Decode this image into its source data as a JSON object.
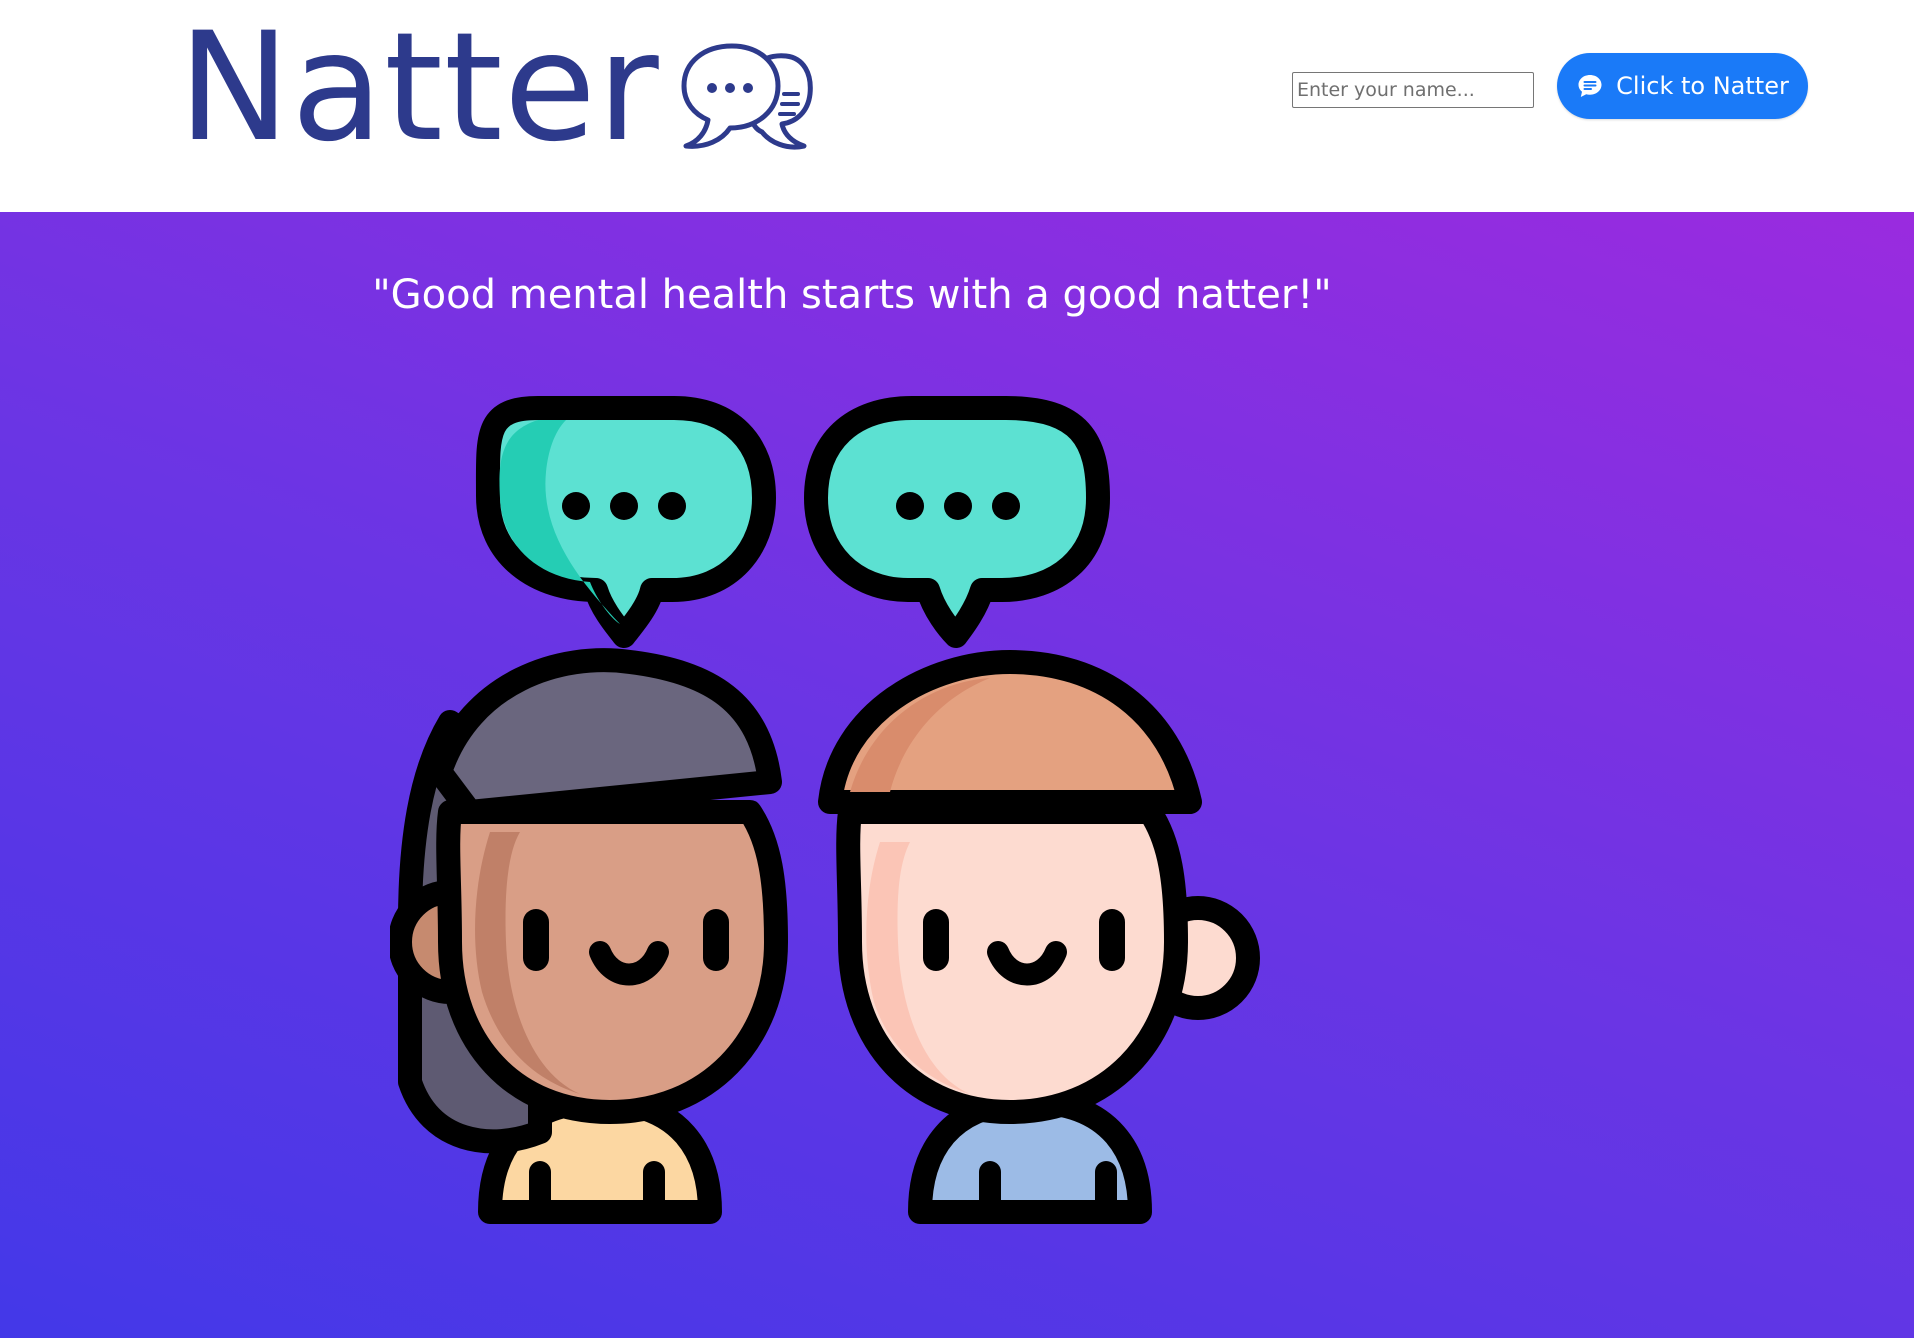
{
  "header": {
    "logo_text": "Natter",
    "name_input": {
      "value": "",
      "placeholder": "Enter your name..."
    },
    "button_label": "Click to Natter"
  },
  "hero": {
    "tagline": "\"Good mental health starts with a good natter!\""
  },
  "colors": {
    "logo": "#2d3a8c",
    "button": "#1a7af8",
    "gradient_start": "#4338e8",
    "gradient_end": "#9a2bdf",
    "bubble": "#5ce1d2"
  },
  "icons": {
    "logo_icon": "chat-bubbles-icon",
    "button_icon": "message-icon"
  }
}
